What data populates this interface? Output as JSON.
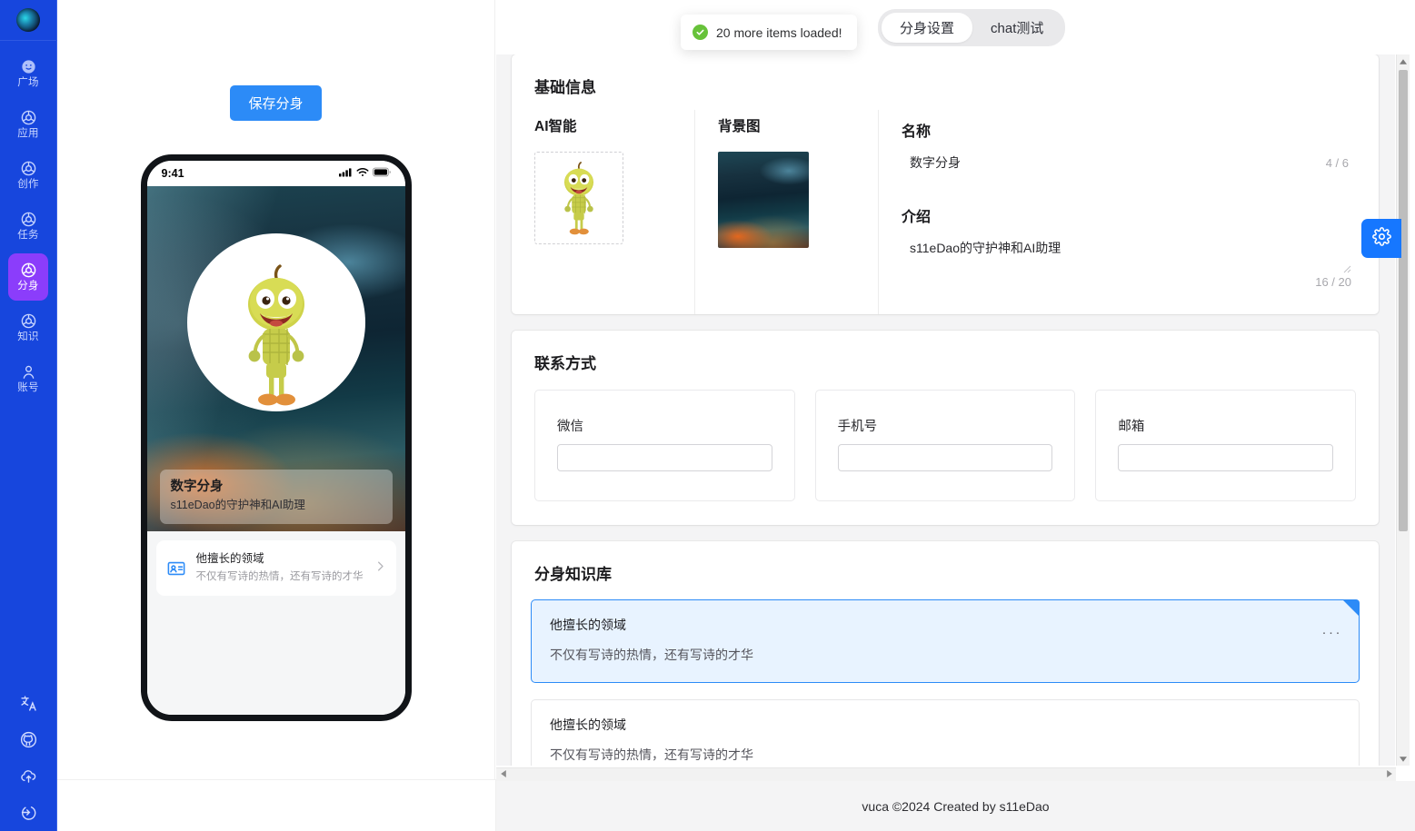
{
  "sidebar": {
    "avatar_name": "user-avatar",
    "items": [
      {
        "label": "广场",
        "icon": "smiley-icon",
        "active": false
      },
      {
        "label": "应用",
        "icon": "swirl-icon",
        "active": false
      },
      {
        "label": "创作",
        "icon": "swirl-icon",
        "active": false
      },
      {
        "label": "任务",
        "icon": "swirl-icon",
        "active": false
      },
      {
        "label": "分身",
        "icon": "swirl-icon",
        "active": true
      },
      {
        "label": "知识",
        "icon": "swirl-icon",
        "active": false
      },
      {
        "label": "账号",
        "icon": "person-icon",
        "active": false
      }
    ],
    "bottom_icons": [
      "translate-icon",
      "github-icon",
      "cloud-upload-icon",
      "logout-icon"
    ],
    "active_color": "#8b3dfb",
    "background_color": "#1746dd"
  },
  "toast": {
    "message": "20 more items loaded!",
    "status": "success",
    "color": "#67c23a"
  },
  "tabs": {
    "items": [
      {
        "label": "分身设置",
        "active": true
      },
      {
        "label": "chat测试",
        "active": false
      }
    ]
  },
  "preview": {
    "save_button": "保存分身",
    "phone": {
      "status_time": "9:41",
      "hero_title": "数字分身",
      "hero_subtitle": "s11eDao的守护神和AI助理",
      "knowledge_title": "他擅长的领域",
      "knowledge_subtitle": "不仅有写诗的热情，还有写诗的才华"
    }
  },
  "basic_info": {
    "title": "基础信息",
    "avatar_label": "AI智能",
    "background_label": "背景图",
    "name_label": "名称",
    "name_value": "数字分身",
    "name_counter": "4 / 6",
    "intro_label": "介绍",
    "intro_value": "s11eDao的守护神和AI助理",
    "intro_counter": "16 / 20"
  },
  "contact": {
    "title": "联系方式",
    "fields": [
      {
        "label": "微信",
        "value": "",
        "placeholder": ""
      },
      {
        "label": "手机号",
        "value": "",
        "placeholder": ""
      },
      {
        "label": "邮箱",
        "value": "",
        "placeholder": ""
      }
    ]
  },
  "knowledge_base": {
    "title": "分身知识库",
    "items": [
      {
        "title": "他擅长的领域",
        "subtitle": "不仅有写诗的热情，还有写诗的才华",
        "selected": true,
        "menu": "···"
      },
      {
        "title": "他擅长的领域",
        "subtitle": "不仅有写诗的热情，还有写诗的才华",
        "selected": false,
        "menu": ""
      }
    ]
  },
  "gear_button": {
    "icon": "gear-icon",
    "color": "#1677ff"
  },
  "footer": {
    "text": "vuca ©2024 Created by s11eDao"
  }
}
